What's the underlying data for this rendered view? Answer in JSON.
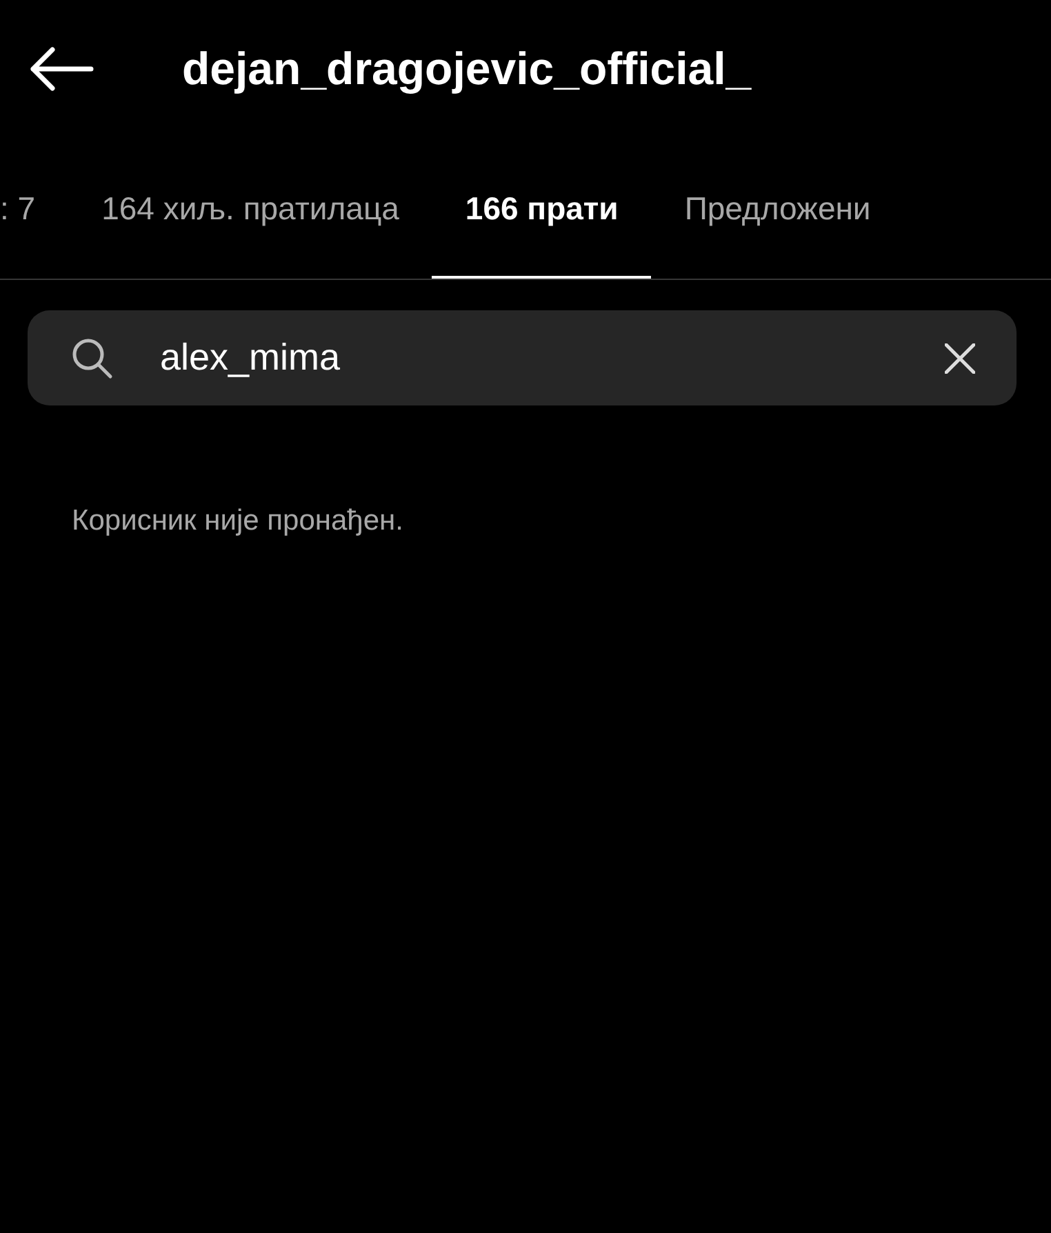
{
  "header": {
    "title": "dejan_dragojevic_official_"
  },
  "tabs": [
    {
      "label": ": 7",
      "selected": false
    },
    {
      "label": "164 хиљ. пратилаца",
      "selected": false
    },
    {
      "label": "166 прати",
      "selected": true
    },
    {
      "label": "Предложени",
      "selected": false
    }
  ],
  "search": {
    "value": "alex_mima"
  },
  "message": "Корисник није пронађен."
}
